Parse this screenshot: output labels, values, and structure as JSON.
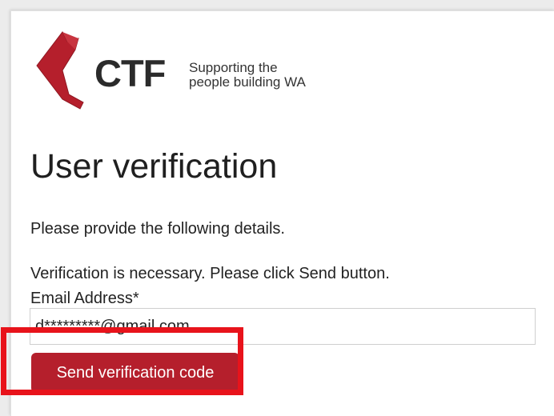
{
  "brand": {
    "name": "CTF",
    "tagline_line1": "Supporting the",
    "tagline_line2": "people building WA",
    "logo_icon": "ctf-logo-mark-icon",
    "accent_color": "#b51f2c"
  },
  "page": {
    "title": "User verification",
    "intro": "Please provide the following details.",
    "notice": "Verification is necessary. Please click Send button."
  },
  "form": {
    "email_label": "Email Address*",
    "email_value": "d*********@gmail.com",
    "send_button_label": "Send verification code"
  },
  "annotation": {
    "highlight_color": "#e8131b"
  }
}
